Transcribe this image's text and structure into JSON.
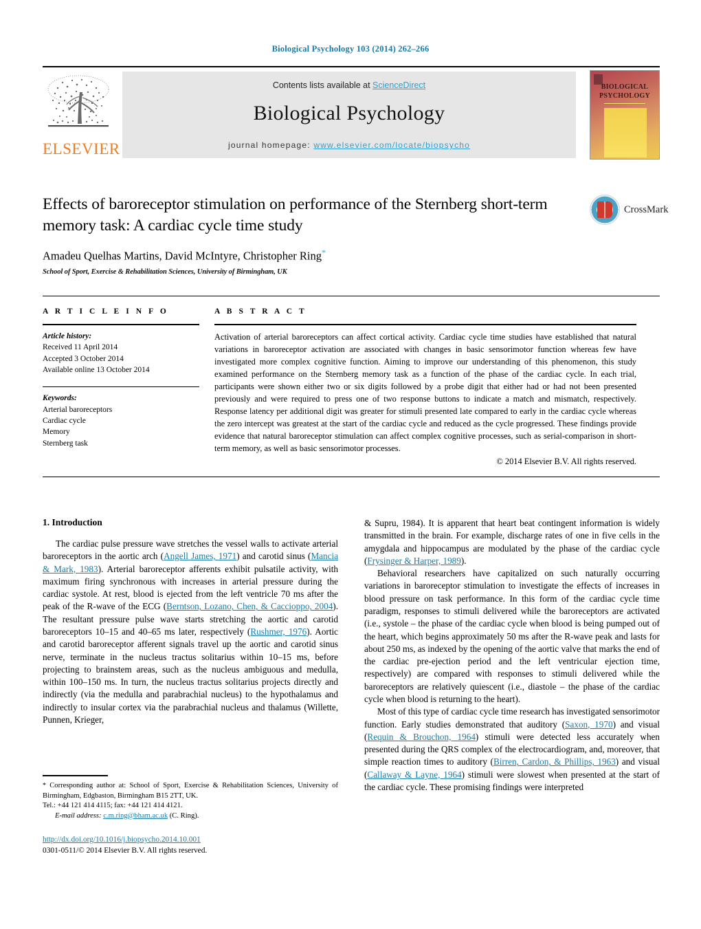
{
  "running_head": "Biological Psychology 103 (2014) 262–266",
  "masthead": {
    "contents_prefix": "Contents lists available at ",
    "sciencedirect": "ScienceDirect",
    "journal_name": "Biological Psychology",
    "homepage_prefix": "journal homepage:",
    "homepage_url": "www.elsevier.com/locate/biopsycho",
    "publisher": "ELSEVIER",
    "cover_title_line1": "BIOLOGICAL",
    "cover_title_line2": "PSYCHOLOGY"
  },
  "article": {
    "title": "Effects of baroreceptor stimulation on performance of the Sternberg short-term memory task: A cardiac cycle time study",
    "authors": "Amadeu Quelhas Martins, David McIntyre, Christopher Ring",
    "corresponding_marker": "*",
    "affiliation": "School of Sport, Exercise & Rehabilitation Sciences, University of Birmingham, UK",
    "crossmark_label": "CrossMark"
  },
  "info": {
    "heading": "A R T I C L E   I N F O",
    "history_heading": "Article history:",
    "history": [
      "Received 11 April 2014",
      "Accepted 3 October 2014",
      "Available online 13 October 2014"
    ],
    "keywords_heading": "Keywords:",
    "keywords": [
      "Arterial baroreceptors",
      "Cardiac cycle",
      "Memory",
      "Sternberg task"
    ]
  },
  "abstract": {
    "heading": "A B S T R A C T",
    "text": "Activation of arterial baroreceptors can affect cortical activity. Cardiac cycle time studies have established that natural variations in baroreceptor activation are associated with changes in basic sensorimotor function whereas few have investigated more complex cognitive function. Aiming to improve our understanding of this phenomenon, this study examined performance on the Sternberg memory task as a function of the phase of the cardiac cycle. In each trial, participants were shown either two or six digits followed by a probe digit that either had or had not been presented previously and were required to press one of two response buttons to indicate a match and mismatch, respectively. Response latency per additional digit was greater for stimuli presented late compared to early in the cardiac cycle whereas the zero intercept was greatest at the start of the cardiac cycle and reduced as the cycle progressed. These findings provide evidence that natural baroreceptor stimulation can affect complex cognitive processes, such as serial-comparison in short-term memory, as well as basic sensorimotor processes.",
    "copyright": "© 2014 Elsevier B.V. All rights reserved."
  },
  "introduction": {
    "heading": "1.  Introduction",
    "left_p1_a": "The cardiac pulse pressure wave stretches the vessel walls to activate arterial baroreceptors in the aortic arch (",
    "left_p1_ref1": "Angell James, 1971",
    "left_p1_b": ") and carotid sinus (",
    "left_p1_ref2": "Mancia & Mark, 1983",
    "left_p1_c": "). Arterial baroreceptor afferents exhibit pulsatile activity, with maximum firing synchronous with increases in arterial pressure during the cardiac systole. At rest, blood is ejected from the left ventricle 70 ms after the peak of the R-wave of the ECG (",
    "left_p1_ref3": "Berntson, Lozano, Chen, & Caccioppo, 2004",
    "left_p1_d": "). The resultant pressure pulse wave starts stretching the aortic and carotid baroreceptors 10–15 and 40–65 ms later, respectively (",
    "left_p1_ref4": "Rushmer, 1976",
    "left_p1_e": "). Aortic and carotid baroreceptor afferent signals travel up the aortic and carotid sinus nerve, terminate in the nucleus tractus solitarius within 10–15 ms, before projecting to brainstem areas, such as the nucleus ambiguous and medulla, within 100–150 ms. In turn, the nucleus tractus solitarius projects directly and indirectly (via the medulla and parabrachial nucleus) to the hypothalamus and indirectly to insular cortex via the parabrachial nucleus and thalamus (Willette, Punnen, Krieger,",
    "right_p1_a": "& Supru, 1984). It is apparent that heart beat contingent information is widely transmitted in the brain. For example, discharge rates of one in five cells in the amygdala and hippocampus are modulated by the phase of the cardiac cycle (",
    "right_p1_ref1": "Frysinger & Harper, 1989",
    "right_p1_b": ").",
    "right_p2_a": "Behavioral researchers have capitalized on such naturally occurring variations in baroreceptor stimulation to investigate the effects of increases in blood pressure on task performance. In this form of the cardiac cycle time paradigm, responses to stimuli delivered while the baroreceptors are activated (i.e., systole – the phase of the cardiac cycle when blood is being pumped out of the heart, which begins approximately 50 ms after the R-wave peak and lasts for about 250 ms, as indexed by the opening of the aortic valve that marks the end of the cardiac pre-ejection period and the left ventricular ejection time, respectively) are compared with responses to stimuli delivered while the baroreceptors are relatively quiescent (i.e., diastole – the phase of the cardiac cycle when blood is returning to the heart).",
    "right_p3_a": "Most of this type of cardiac cycle time research has investigated sensorimotor function. Early studies demonstrated that auditory (",
    "right_p3_ref1": "Saxon, 1970",
    "right_p3_b": ") and visual (",
    "right_p3_ref2": "Requin & Brouchon, 1964",
    "right_p3_c": ") stimuli were detected less accurately when presented during the QRS complex of the electrocardiogram, and, moreover, that simple reaction times to auditory (",
    "right_p3_ref3": "Birren, Cardon, & Phillips, 1963",
    "right_p3_d": ") and visual (",
    "right_p3_ref4": "Callaway & Layne, 1964",
    "right_p3_e": ") stimuli were slowest when presented at the start of the cardiac cycle. These promising findings were interpreted"
  },
  "footnote": {
    "star": "*",
    "text_a": " Corresponding author at: School of Sport, Exercise & Rehabilitation Sciences, University of Birmingham, Edgbaston, Birmingham B15 2TT, UK.",
    "tel": "Tel.: +44 121 414 4115; fax: +44 121 414 4121.",
    "email_label": "E-mail address:",
    "email": "c.m.ring@bham.ac.uk",
    "email_suffix": " (C. Ring)."
  },
  "doi": {
    "url": "http://dx.doi.org/10.1016/j.biopsycho.2014.10.001",
    "issn": "0301-0511/© 2014 Elsevier B.V. All rights reserved."
  }
}
